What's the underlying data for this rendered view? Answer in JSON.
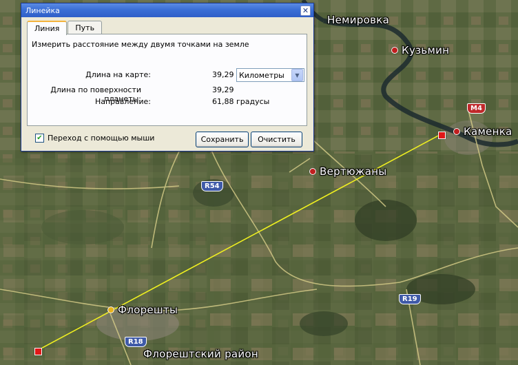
{
  "dialog": {
    "title": "Линейка",
    "tabs": [
      {
        "label": "Линия",
        "active": true
      },
      {
        "label": "Путь",
        "active": false
      }
    ],
    "description": "Измерить расстояние между двумя точками на земле",
    "map_length_label": "Длина на карте:",
    "map_length_value": "39,29",
    "unit_selected": "Километры",
    "surface_length_label": "Длина по поверхности планеты:",
    "surface_length_value": "39,29",
    "heading_label": "Направление:",
    "heading_value": "61,88 градусы",
    "mouse_nav_label": "Переход с помощью мыши",
    "mouse_nav_checked": true,
    "save_label": "Сохранить",
    "clear_label": "Очистить"
  },
  "map": {
    "places": [
      {
        "name": "Немировка",
        "dot": false
      },
      {
        "name": "Кузьмин",
        "dot": true
      },
      {
        "name": "Каменка",
        "dot": true
      },
      {
        "name": "Вертюжаны",
        "dot": true
      },
      {
        "name": "Флорешты",
        "dot": true
      },
      {
        "name": "Флорештский район",
        "dot": false
      }
    ],
    "road_shields": [
      "R54",
      "M4",
      "R19",
      "R18"
    ],
    "measure_line_color": "#f0f020"
  }
}
